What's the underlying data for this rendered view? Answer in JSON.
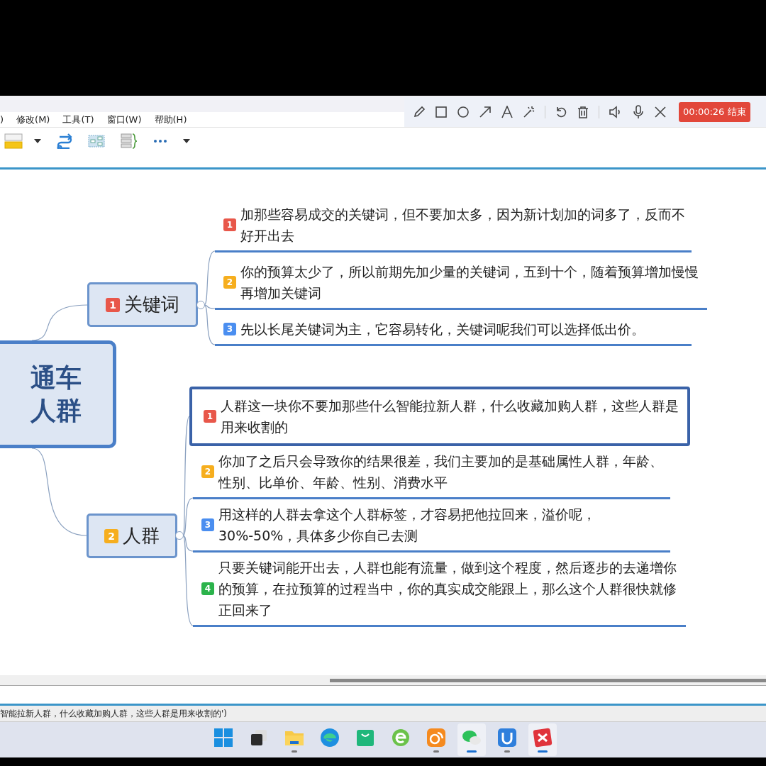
{
  "menu": [
    ")",
    "修改(M)",
    "工具(T)",
    "窗口(W)",
    "帮助(H)"
  ],
  "recorder": {
    "timer": "00:00:26 结束"
  },
  "mindmap": {
    "root": {
      "lines": [
        "通车",
        "人群"
      ]
    },
    "branches": [
      {
        "badge": "1",
        "color": "#e8574a",
        "label": "关键词",
        "children": [
          {
            "badge": "1",
            "color": "#e8574a",
            "text": "加那些容易成交的关键词，但不要加太多，因为新计划加的词多了，反而不好开出去",
            "selected": false
          },
          {
            "badge": "2",
            "color": "#f6ae1e",
            "text": "你的预算太少了，所以前期先加少量的关键词，五到十个，随着预算增加慢慢再增加关键词",
            "selected": false
          },
          {
            "badge": "3",
            "color": "#4a8ef0",
            "text": "先以长尾关键词为主，它容易转化，关键词呢我们可以选择低出价。",
            "selected": false
          }
        ]
      },
      {
        "badge": "2",
        "color": "#f6ae1e",
        "label": "人群",
        "children": [
          {
            "badge": "1",
            "color": "#e8574a",
            "text": "人群这一块你不要加那些什么智能拉新人群，什么收藏加购人群，这些人群是用来收割的",
            "selected": true
          },
          {
            "badge": "2",
            "color": "#f6ae1e",
            "text": "你加了之后只会导致你的结果很差，我们主要加的是基础属性人群，年龄、性别、比单价、年龄、性别、消费水平",
            "selected": false
          },
          {
            "badge": "3",
            "color": "#4a8ef0",
            "text": "用这样的人群去拿这个人群标签，才容易把他拉回来，溢价呢，30%-50%，具体多少你自己去测",
            "selected": false
          },
          {
            "badge": "4",
            "color": "#2bb34b",
            "text": "只要关键词能开出去，人群也能有流量，做到这个程度，然后逐步的去递增你的预算，在拉预算的过程当中，你的真实成交能跟上，那么这个人群很快就修正回来了",
            "selected": false
          }
        ]
      }
    ]
  },
  "status_text": "智能拉新人群，什么收藏加购人群，这些人群是用来收割的')",
  "taskbar": [
    {
      "kind": "start",
      "running": false,
      "active": false
    },
    {
      "kind": "taskview",
      "running": false,
      "active": false
    },
    {
      "kind": "folder",
      "running": true,
      "active": false
    },
    {
      "kind": "browser",
      "running": false,
      "active": false
    },
    {
      "kind": "bag",
      "running": false,
      "active": false
    },
    {
      "kind": "ebrowser",
      "running": false,
      "active": false
    },
    {
      "kind": "squirrel",
      "running": true,
      "active": false
    },
    {
      "kind": "chat",
      "running": true,
      "active": true
    },
    {
      "kind": "shield",
      "running": true,
      "active": false
    },
    {
      "kind": "xmind",
      "running": true,
      "active": true
    }
  ]
}
